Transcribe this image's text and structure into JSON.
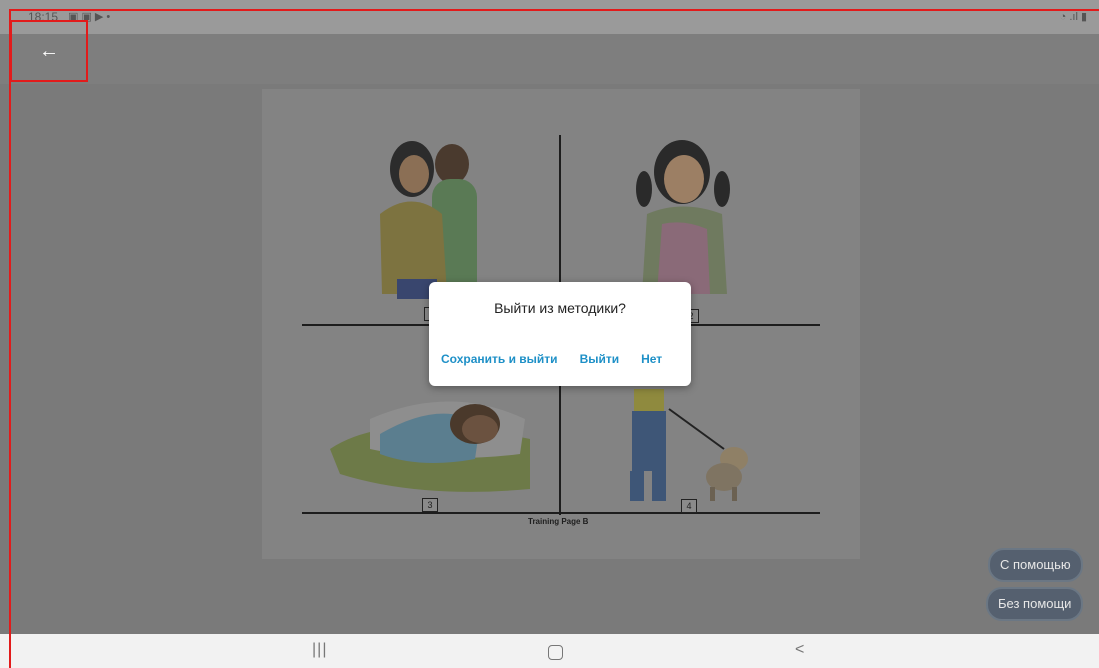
{
  "status_bar": {
    "time": "18:15",
    "left_icons": "▣ ▣ ▶ •",
    "right_icons": "◔ .ıl ▮"
  },
  "app_bar": {
    "back_icon": "←"
  },
  "picture": {
    "quadrant_labels": [
      "1",
      "2",
      "3",
      "4"
    ],
    "caption": "Training Page B"
  },
  "dialog": {
    "title": "Выйти из методики?",
    "actions": [
      "Сохранить и выйти",
      "Выйти",
      "Нет"
    ]
  },
  "floating_buttons": {
    "with_help": "С помощью",
    "without_help": "Без помощи"
  },
  "nav_bar": {
    "recents": "|||",
    "home": "○",
    "back": "<"
  },
  "colors": {
    "accent": "#1e90c7",
    "highlight": "#e21b1b"
  }
}
